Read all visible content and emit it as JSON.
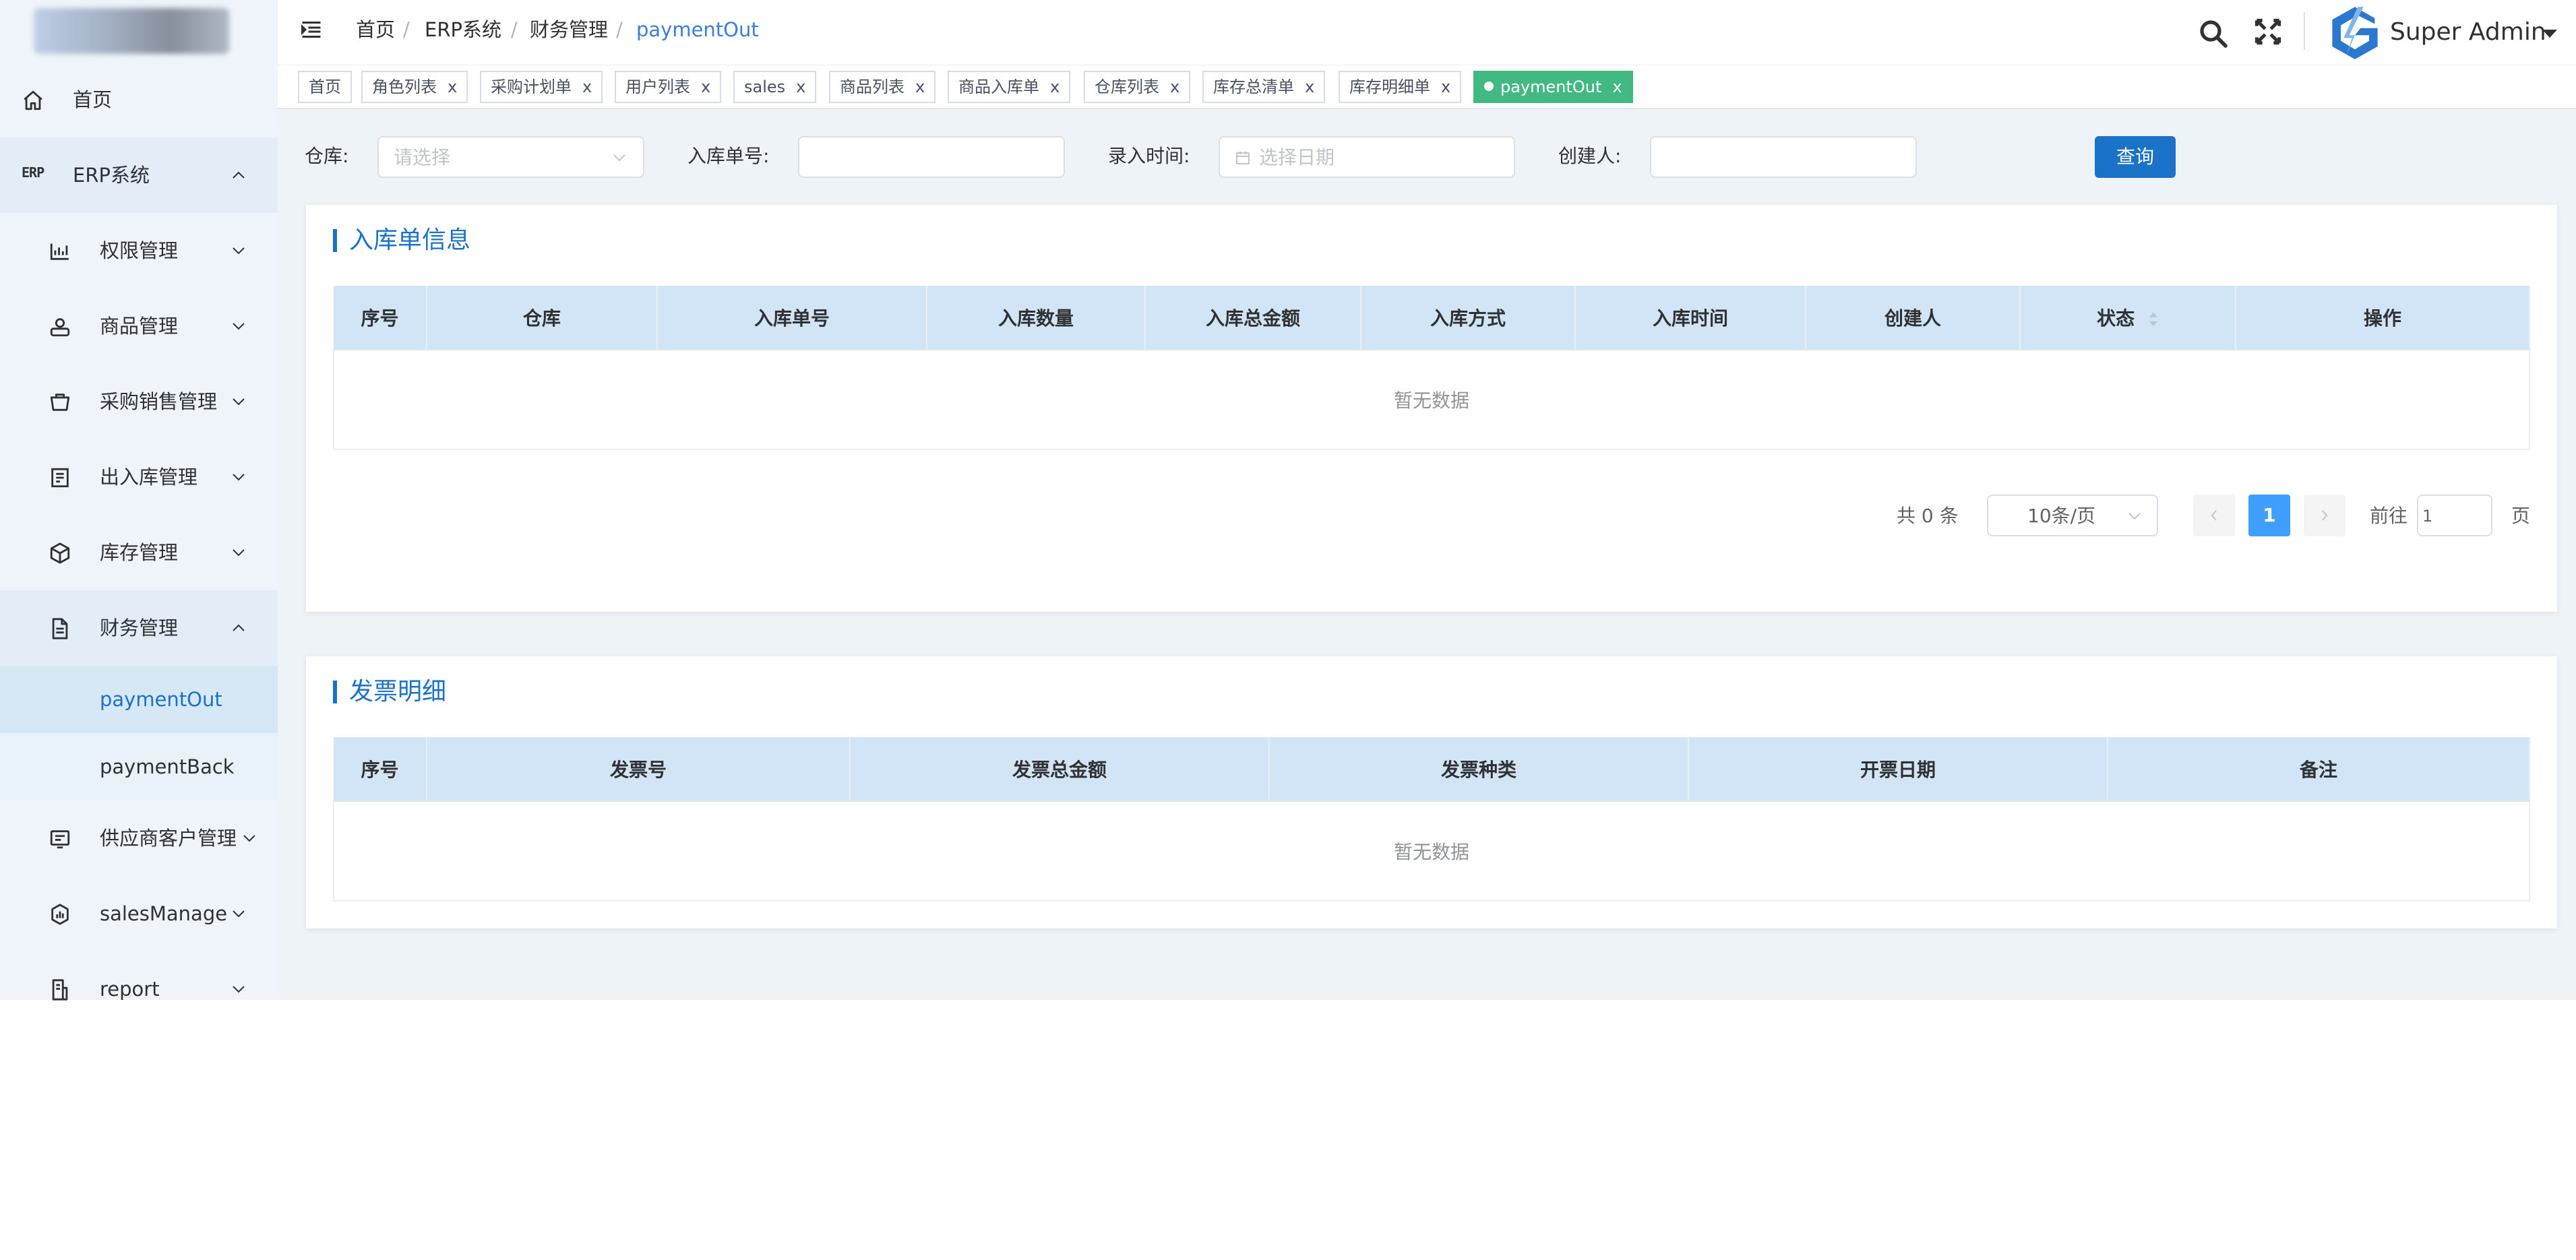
{
  "header": {
    "breadcrumbs": [
      "首页",
      "ERP系统",
      "财务管理",
      "paymentOut"
    ],
    "user_name": "Super Admin"
  },
  "sidebar": {
    "items": [
      {
        "label": "首页",
        "icon": "home-icon"
      },
      {
        "label": "ERP系统",
        "icon_text": "ERP"
      },
      {
        "label": "权限管理",
        "icon": "permission-icon"
      },
      {
        "label": "商品管理",
        "icon": "goods-icon"
      },
      {
        "label": "采购销售管理",
        "icon": "purchase-icon"
      },
      {
        "label": "出入库管理",
        "icon": "stock-io-icon"
      },
      {
        "label": "库存管理",
        "icon": "box-icon"
      },
      {
        "label": "财务管理",
        "icon": "document-icon"
      },
      {
        "label": "paymentOut"
      },
      {
        "label": "paymentBack"
      },
      {
        "label": "供应商客户管理",
        "icon": "supplier-icon"
      },
      {
        "label": "salesManage",
        "icon": "sales-icon"
      },
      {
        "label": "report",
        "icon": "report-icon"
      }
    ]
  },
  "tags": [
    {
      "label": "首页"
    },
    {
      "label": "角色列表",
      "close": "x"
    },
    {
      "label": "采购计划单",
      "close": "x"
    },
    {
      "label": "用户列表",
      "close": "x"
    },
    {
      "label": "sales",
      "close": "x"
    },
    {
      "label": "商品列表",
      "close": "x"
    },
    {
      "label": "商品入库单",
      "close": "x"
    },
    {
      "label": "仓库列表",
      "close": "x"
    },
    {
      "label": "库存总清单",
      "close": "x"
    },
    {
      "label": "库存明细单",
      "close": "x"
    },
    {
      "label": "paymentOut",
      "close": "x"
    }
  ],
  "filters": {
    "warehouse_label": "仓库:",
    "warehouse_placeholder": "请选择",
    "order_no_label": "入库单号:",
    "order_no_value": "",
    "time_label": "录入时间:",
    "time_placeholder": "选择日期",
    "creator_label": "创建人:",
    "creator_value": "",
    "query_button": "查询"
  },
  "inbound_card": {
    "title": "入库单信息",
    "columns": [
      "序号",
      "仓库",
      "入库单号",
      "入库数量",
      "入库总金额",
      "入库方式",
      "入库时间",
      "创建人",
      "状态",
      "操作"
    ],
    "empty_text": "暂无数据"
  },
  "pagination": {
    "total_text": "共 0 条",
    "page_size": "10条/页",
    "current_page": "1",
    "goto_label": "前往",
    "goto_value": "1",
    "page_suffix": "页"
  },
  "invoice_card": {
    "title": "发票明细",
    "columns": [
      "序号",
      "发票号",
      "发票总金额",
      "发票种类",
      "开票日期",
      "备注"
    ],
    "empty_text": "暂无数据"
  },
  "colors": {
    "primary": "#1a73c9",
    "active_tag": "#42b983",
    "table_header": "#d1e5f6",
    "page_active": "#409eff"
  }
}
